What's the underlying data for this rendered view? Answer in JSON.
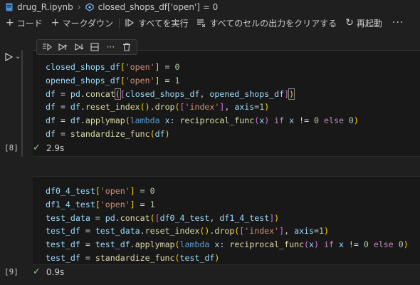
{
  "breadcrumb": {
    "file": "drug_R.ipynb",
    "symbol": "closed_shops_df['open'] = 0"
  },
  "toolbar": {
    "add_code": "コード",
    "add_markdown": "マークダウン",
    "run_all": "すべてを実行",
    "clear_outputs": "すべてのセルの出力をクリアする",
    "restart": "再起動",
    "more": "···"
  },
  "cells": [
    {
      "exec_count": "[8]",
      "duration": "2.9s",
      "lines": [
        "closed_shops_df['open'] = 0",
        "opened_shops_df['open'] = 1",
        "df = pd.concat([closed_shops_df, opened_shops_df])",
        "df = df.reset_index().drop(['index'], axis=1)",
        "df = df.applymap(lambda x: reciprocal_func(x) if x != 0 else 0)",
        "df = standardize_func(df)"
      ]
    },
    {
      "exec_count": "[9]",
      "duration": "0.9s",
      "lines": [
        "df0_4_test['open'] = 0",
        "df1_4_test['open'] = 1",
        "test_data = pd.concat([df0_4_test, df1_4_test])",
        "test_df = test_data.reset_index().drop(['index'], axis=1)",
        "test_df = test_df.applymap(lambda x: reciprocal_func(x) if x != 0 else 0)",
        "test_df = standardize_func(test_df)"
      ]
    }
  ],
  "colors": {
    "background": "#1f1f1f",
    "cell_background": "#181818",
    "success_check": "#89d185",
    "string": "#ce9178",
    "keyword": "#569cd6",
    "control_keyword": "#c586c0",
    "function": "#dcdcaa",
    "number": "#b5cea8",
    "variable": "#9cdcfe"
  },
  "icons": {
    "file": "notebook-file-icon",
    "symbol": "symbol-class-icon",
    "cell_toolbar": [
      "run-by-line-icon",
      "execute-above-icon",
      "execute-below-icon",
      "split-cell-icon",
      "more-icon",
      "delete-icon"
    ]
  }
}
